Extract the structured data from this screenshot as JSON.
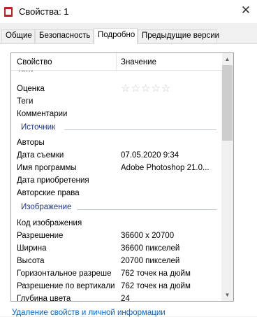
{
  "window": {
    "title": "Свойства: 1",
    "close_glyph": "✕"
  },
  "tabs": [
    {
      "label": "Общие"
    },
    {
      "label": "Безопасность"
    },
    {
      "label": "Подробно"
    },
    {
      "label": "Предыдущие версии"
    }
  ],
  "list": {
    "columns": {
      "property": "Свойство",
      "value": "Значение"
    },
    "cut_row": "Теги",
    "rows_top": [
      {
        "property": "Оценка",
        "value": ""
      },
      {
        "property": "Теги",
        "value": ""
      },
      {
        "property": "Комментарии",
        "value": ""
      }
    ],
    "rating": {
      "stars": "☆☆☆☆☆",
      "value": 0,
      "max": 5
    },
    "group_source": "Источник",
    "rows_source": [
      {
        "property": "Авторы",
        "value": ""
      },
      {
        "property": "Дата съемки",
        "value": "07.05.2020 9:34"
      },
      {
        "property": "Имя программы",
        "value": "Adobe Photoshop 21.0..."
      },
      {
        "property": "Дата приобретения",
        "value": ""
      },
      {
        "property": "Авторские права",
        "value": ""
      }
    ],
    "group_image": "Изображение",
    "rows_image": [
      {
        "property": "Код изображения",
        "value": ""
      },
      {
        "property": "Разрешение",
        "value": "36600 x 20700"
      },
      {
        "property": "Ширина",
        "value": "36600 пикселей"
      },
      {
        "property": "Высота",
        "value": "20700 пикселей"
      },
      {
        "property": "Горизонтальное разреше",
        "value": "762 точек на дюйм"
      },
      {
        "property": "Разрешение по вертикали",
        "value": "762 точек на дюйм"
      },
      {
        "property": "Глубина цвета",
        "value": "24"
      }
    ]
  },
  "footer": {
    "remove_link": "Удаление свойств и личной информации"
  }
}
